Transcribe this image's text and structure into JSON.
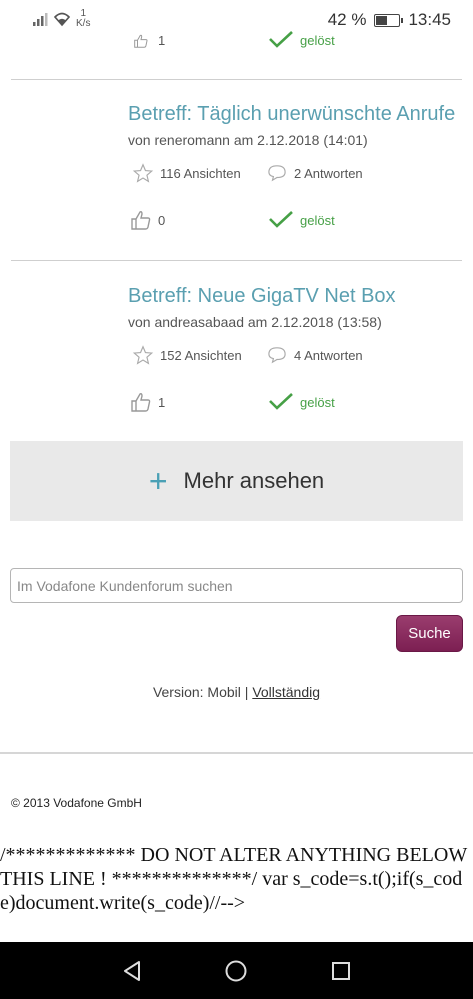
{
  "status_bar": {
    "speed_value": "1",
    "speed_unit": "K/s",
    "battery_text": "42 %",
    "battery_level": 0.42,
    "time": "13:45"
  },
  "posts": [
    {
      "kudos": "1",
      "solved_label": "gelöst"
    },
    {
      "title": "Betreff: Täglich unerwünschte Anrufe",
      "meta": "von reneromann am 2.12.2018 (14:01)",
      "views": "116 Ansichten",
      "replies": "2 Antworten",
      "kudos": "0",
      "solved_label": "gelöst"
    },
    {
      "title": "Betreff: Neue GigaTV Net Box",
      "meta": "von andreasabaad am 2.12.2018 (13:58)",
      "views": "152 Ansichten",
      "replies": "4 Antworten",
      "kudos": "1",
      "solved_label": "gelöst"
    }
  ],
  "more_button": {
    "icon": "+",
    "label": "Mehr ansehen"
  },
  "search": {
    "placeholder": "Im Vodafone Kundenforum suchen",
    "button_label": "Suche"
  },
  "version": {
    "prefix": "Version: Mobil |",
    "full_link": "Vollständig"
  },
  "footer": {
    "copyright": "© 2013 Vodafone GmbH",
    "code_text": "/************* DO NOT ALTER ANYTHING BELOW THIS LINE ! **************/ var s_code=s.t();if(s_code)document.write(s_code)//-->"
  },
  "colors": {
    "title": "#5a9fb0",
    "solved_green": "#46a046",
    "search_button": "#7c1f52",
    "more_box_bg": "#e9e9e9"
  }
}
